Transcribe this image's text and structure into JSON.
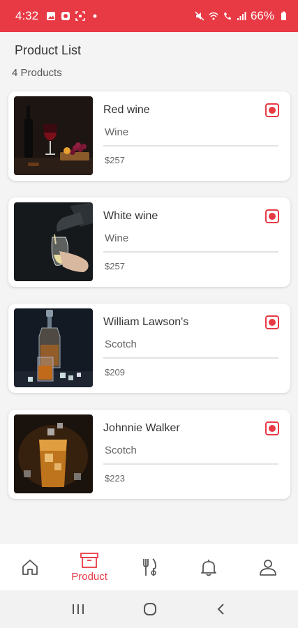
{
  "status_bar": {
    "time": "4:32",
    "battery": "66%",
    "icons": [
      "image-icon",
      "app-icon",
      "screenshot-icon",
      "dot-icon",
      "mute-icon",
      "wifi-icon",
      "wifi-call-icon",
      "signal-icon",
      "battery-icon"
    ]
  },
  "header": {
    "title": "Product List",
    "count": "4 Products"
  },
  "products": [
    {
      "name": "Red wine",
      "category": "Wine",
      "price": "$257",
      "image": "red-wine-image"
    },
    {
      "name": "White wine",
      "category": "Wine",
      "price": "$257",
      "image": "white-wine-image"
    },
    {
      "name": "William Lawson's",
      "category": "Scotch",
      "price": "$209",
      "image": "william-lawsons-image"
    },
    {
      "name": "Johnnie Walker",
      "category": "Scotch",
      "price": "$223",
      "image": "johnnie-walker-image"
    }
  ],
  "bottom_nav": {
    "items": [
      {
        "icon": "home-icon",
        "label": ""
      },
      {
        "icon": "archive-box-icon",
        "label": "Product",
        "active": true
      },
      {
        "icon": "fork-knife-icon",
        "label": ""
      },
      {
        "icon": "bell-icon",
        "label": ""
      },
      {
        "icon": "user-icon",
        "label": ""
      }
    ]
  },
  "colors": {
    "accent": "#e83a45",
    "background": "#f4f4f4",
    "card": "#ffffff"
  }
}
